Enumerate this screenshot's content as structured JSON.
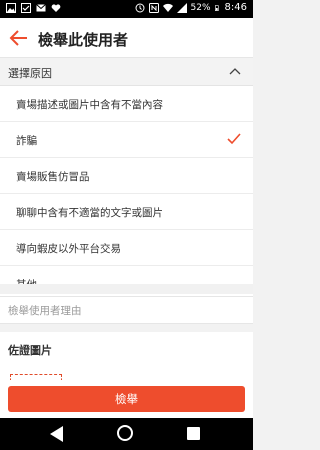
{
  "status_bar": {
    "time": "8:46",
    "battery": "52%",
    "icons": [
      "image-icon",
      "checkbox-icon",
      "mail-icon",
      "heart-icon",
      "sync-icon",
      "nfc-icon",
      "wifi-icon",
      "signal-icon",
      "battery-icon"
    ]
  },
  "header": {
    "title": "檢舉此使用者",
    "back_icon": "arrow-left-icon"
  },
  "section": {
    "label": "選擇原因",
    "toggle_icon": "chevron-up-icon"
  },
  "reasons": [
    {
      "label": "賣場描述或圖片中含有不當內容",
      "selected": false
    },
    {
      "label": "詐騙",
      "selected": true
    },
    {
      "label": "賣場販售仿冒品",
      "selected": false
    },
    {
      "label": "聊聊中含有不適當的文字或圖片",
      "selected": false
    },
    {
      "label": "導向蝦皮以外平台交易",
      "selected": false
    },
    {
      "label": "其他",
      "selected": false
    }
  ],
  "reason_input": {
    "placeholder": "檢舉使用者理由",
    "value": ""
  },
  "photos": {
    "label": "佐證圖片"
  },
  "submit": {
    "label": "檢舉"
  },
  "colors": {
    "accent": "#ee4d2d",
    "status_bar": "#000000"
  }
}
